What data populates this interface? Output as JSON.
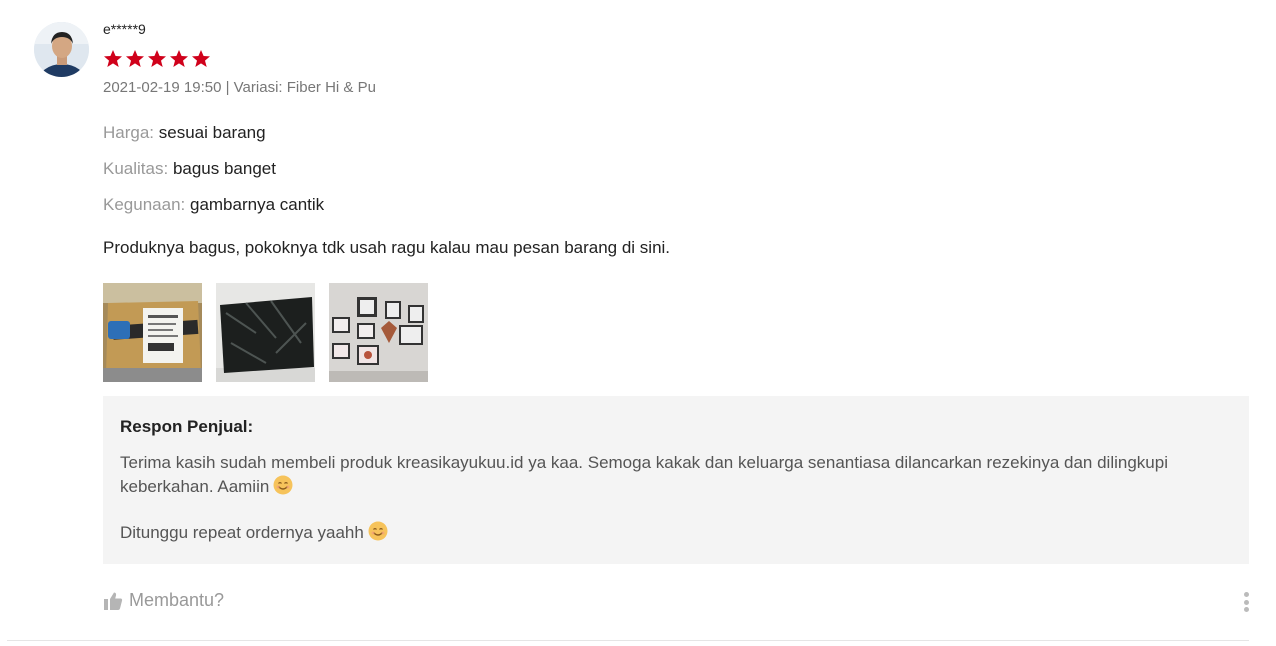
{
  "review": {
    "author": "e*****9",
    "rating": 5,
    "rating_max": 5,
    "star_color": "#d0011b",
    "meta": "2021-02-19 19:50 | Variasi: Fiber Hi & Pu",
    "attributes": [
      {
        "key": "Harga:",
        "value": "sesuai barang"
      },
      {
        "key": "Kualitas:",
        "value": "bagus banget"
      },
      {
        "key": "Kegunaan:",
        "value": "gambarnya cantik"
      }
    ],
    "comment": "Produknya bagus, pokoknya tdk usah ragu kalau mau pesan barang di sini."
  },
  "seller_response": {
    "title": "Respon Penjual:",
    "paragraph1": "Terima kasih sudah membeli produk kreasikayukuu.id ya kaa.  Semoga kakak dan keluarga senantiasa dilancarkan rezekinya dan dilingkupi keberkahan. Aamiin",
    "paragraph2": "Ditunggu repeat ordernya yaahh"
  },
  "actions": {
    "helpful_label": "Membantu?"
  },
  "icons": {
    "helpful": "thumb-up-icon",
    "more": "more-vertical-icon",
    "emoji": "smiling-face-icon"
  }
}
